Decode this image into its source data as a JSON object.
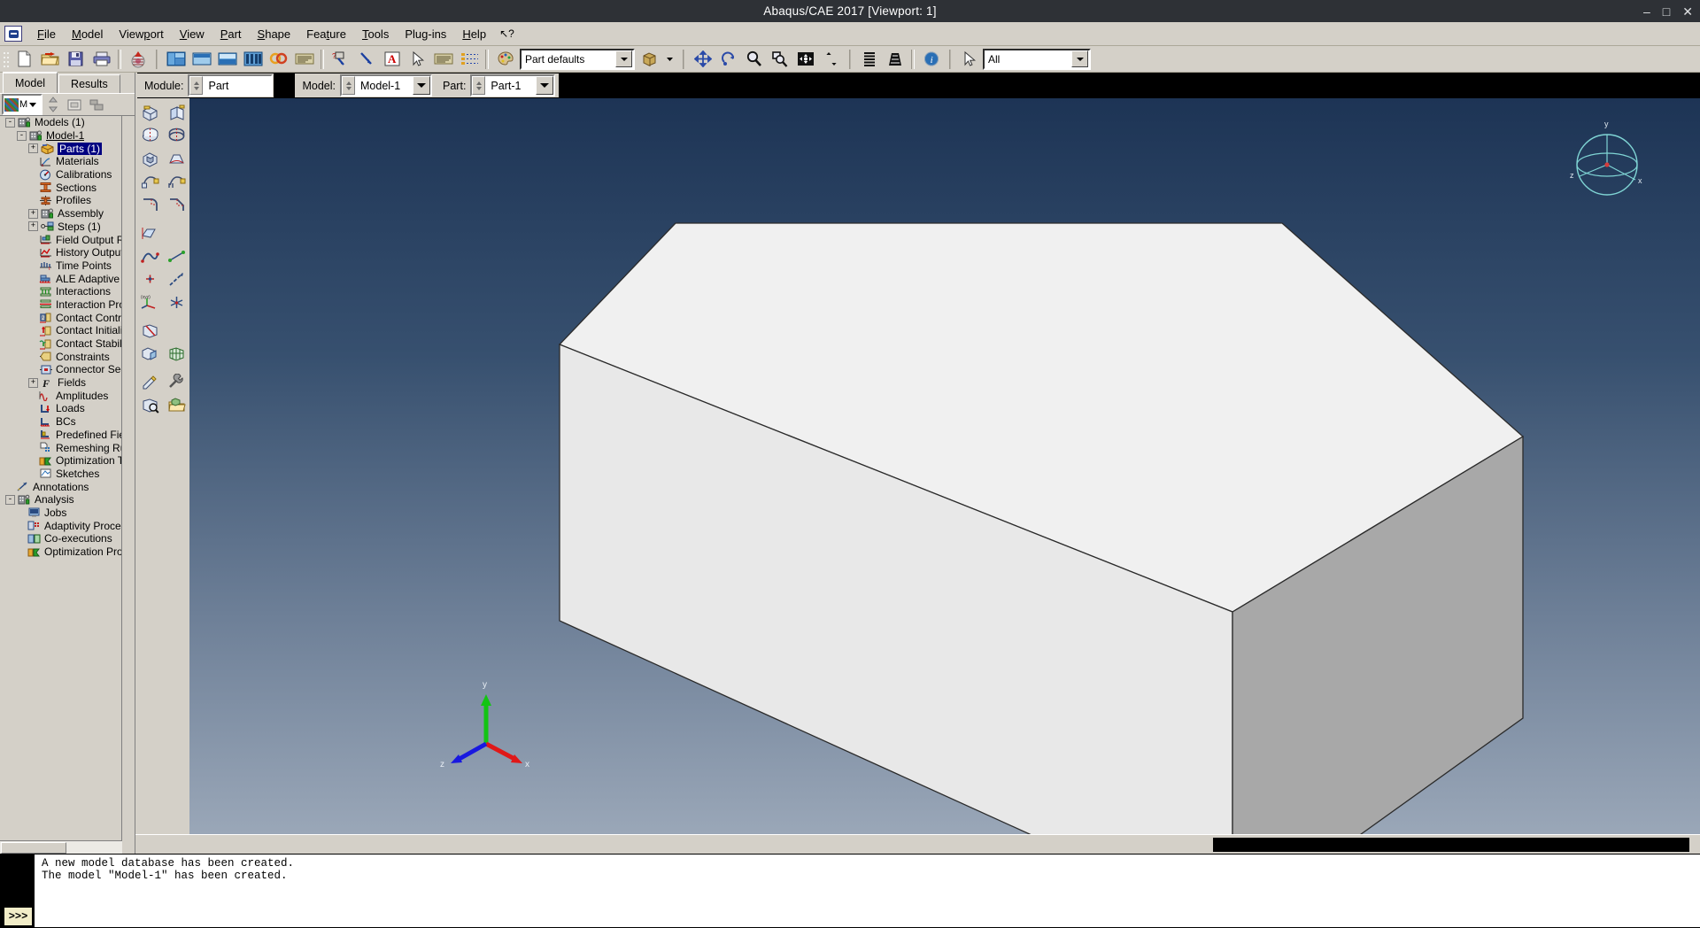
{
  "window": {
    "title": "Abaqus/CAE 2017 [Viewport: 1]",
    "minimize": "–",
    "maximize": "□",
    "close": "✕"
  },
  "menu": {
    "items": [
      {
        "label": "File",
        "accel_index": 0
      },
      {
        "label": "Model",
        "accel_index": 0
      },
      {
        "label": "Viewport",
        "accel_index": 4
      },
      {
        "label": "View",
        "accel_index": 0
      },
      {
        "label": "Part",
        "accel_index": 0
      },
      {
        "label": "Shape",
        "accel_index": 0
      },
      {
        "label": "Feature",
        "accel_index": 4
      },
      {
        "label": "Tools",
        "accel_index": 0
      },
      {
        "label": "Plug-ins",
        "accel_index": 4
      },
      {
        "label": "Help",
        "accel_index": 0
      }
    ],
    "help_arrow": "↖?"
  },
  "toolbar": {
    "file_group": [
      "new-model-database-icon",
      "open-database-icon",
      "save-database-icon",
      "print-icon"
    ],
    "abaqus_icon": "abaqus-home-icon",
    "viewport_group": [
      "create-viewport-icon",
      "tile-vertically-icon",
      "tile-horizontally-icon",
      "viewport-list-icon",
      "link-viewports-icon",
      "viewport-annotations-icon"
    ],
    "query_group": [
      "query-information-icon",
      "probe-values-icon",
      "annotation-text-icon",
      "selection-arrow-icon",
      "datum-icon",
      "display-group-icon"
    ],
    "render_combo_value": "Part defaults",
    "render_combo_placeholder": "Part defaults",
    "render_style_icon": "render-style-icon",
    "view_group": [
      "pan-icon",
      "rotate-icon",
      "magnify-icon",
      "box-zoom-icon",
      "auto-fit-icon",
      "cycle-views-icon"
    ],
    "perspective_group": [
      "perspective-icon",
      "no-perspective-icon"
    ],
    "info_icon": "viewport-info-icon",
    "select_arrow_icon": "select-entity-icon",
    "select_combo_value": "All",
    "select_combo_placeholder": "All"
  },
  "context": {
    "module_label": "Module:",
    "module_value": "Part",
    "model_label": "Model:",
    "model_value": "Model-1",
    "part_label": "Part:",
    "part_value": "Part-1"
  },
  "left_panel": {
    "tabs": [
      {
        "label": "Model",
        "active": true
      },
      {
        "label": "Results",
        "active": false
      }
    ],
    "tree_toolbar": {
      "model_selector_icon": "model-database-icon",
      "model_selector_value": "M",
      "switch_icon": "switch-context-icon",
      "container_icon": "container-icon",
      "filter_icon": "tree-filter-icon"
    },
    "tree": [
      {
        "depth": 0,
        "label": "Models (1)",
        "expander": "-",
        "icon": "models-icon",
        "selected": false,
        "underline": false
      },
      {
        "depth": 1,
        "label": "Model-1",
        "expander": "-",
        "icon": "model-icon",
        "selected": false,
        "underline": true
      },
      {
        "depth": 2,
        "label": "Parts (1)",
        "expander": "+",
        "icon": "parts-icon",
        "selected": true,
        "underline": false
      },
      {
        "depth": 2,
        "label": "Materials",
        "expander": "",
        "icon": "materials-icon",
        "selected": false,
        "underline": false
      },
      {
        "depth": 2,
        "label": "Calibrations",
        "expander": "",
        "icon": "calibrations-icon",
        "selected": false,
        "underline": false
      },
      {
        "depth": 2,
        "label": "Sections",
        "expander": "",
        "icon": "sections-icon",
        "selected": false,
        "underline": false
      },
      {
        "depth": 2,
        "label": "Profiles",
        "expander": "",
        "icon": "profiles-icon",
        "selected": false,
        "underline": false
      },
      {
        "depth": 2,
        "label": "Assembly",
        "expander": "+",
        "icon": "assembly-icon",
        "selected": false,
        "underline": false
      },
      {
        "depth": 2,
        "label": "Steps (1)",
        "expander": "+",
        "icon": "steps-icon",
        "selected": false,
        "underline": false
      },
      {
        "depth": 2,
        "label": "Field Output Requests",
        "expander": "",
        "icon": "field-output-icon",
        "selected": false,
        "underline": false
      },
      {
        "depth": 2,
        "label": "History Output Requests",
        "expander": "",
        "icon": "history-output-icon",
        "selected": false,
        "underline": false
      },
      {
        "depth": 2,
        "label": "Time Points",
        "expander": "",
        "icon": "time-points-icon",
        "selected": false,
        "underline": false
      },
      {
        "depth": 2,
        "label": "ALE Adaptive Mesh Constraints",
        "expander": "",
        "icon": "ale-adaptive-icon",
        "selected": false,
        "underline": false
      },
      {
        "depth": 2,
        "label": "Interactions",
        "expander": "",
        "icon": "interactions-icon",
        "selected": false,
        "underline": false
      },
      {
        "depth": 2,
        "label": "Interaction Properties",
        "expander": "",
        "icon": "interaction-properties-icon",
        "selected": false,
        "underline": false
      },
      {
        "depth": 2,
        "label": "Contact Controls",
        "expander": "",
        "icon": "contact-controls-icon",
        "selected": false,
        "underline": false
      },
      {
        "depth": 2,
        "label": "Contact Initializations",
        "expander": "",
        "icon": "contact-initializations-icon",
        "selected": false,
        "underline": false
      },
      {
        "depth": 2,
        "label": "Contact Stabilizations",
        "expander": "",
        "icon": "contact-stabilizations-icon",
        "selected": false,
        "underline": false
      },
      {
        "depth": 2,
        "label": "Constraints",
        "expander": "",
        "icon": "constraints-icon",
        "selected": false,
        "underline": false
      },
      {
        "depth": 2,
        "label": "Connector Sections",
        "expander": "",
        "icon": "connector-sections-icon",
        "selected": false,
        "underline": false
      },
      {
        "depth": 2,
        "label": "Fields",
        "expander": "+",
        "icon": "fields-icon",
        "selected": false,
        "underline": false
      },
      {
        "depth": 2,
        "label": "Amplitudes",
        "expander": "",
        "icon": "amplitudes-icon",
        "selected": false,
        "underline": false
      },
      {
        "depth": 2,
        "label": "Loads",
        "expander": "",
        "icon": "loads-icon",
        "selected": false,
        "underline": false
      },
      {
        "depth": 2,
        "label": "BCs",
        "expander": "",
        "icon": "bcs-icon",
        "selected": false,
        "underline": false
      },
      {
        "depth": 2,
        "label": "Predefined Fields",
        "expander": "",
        "icon": "predefined-fields-icon",
        "selected": false,
        "underline": false
      },
      {
        "depth": 2,
        "label": "Remeshing Rules",
        "expander": "",
        "icon": "remeshing-rules-icon",
        "selected": false,
        "underline": false
      },
      {
        "depth": 2,
        "label": "Optimization Tasks",
        "expander": "",
        "icon": "optimization-tasks-icon",
        "selected": false,
        "underline": false
      },
      {
        "depth": 2,
        "label": "Sketches",
        "expander": "",
        "icon": "sketches-icon",
        "selected": false,
        "underline": false
      },
      {
        "depth": 0,
        "label": "Annotations",
        "expander": "",
        "icon": "annotations-icon",
        "selected": false,
        "underline": false
      },
      {
        "depth": 0,
        "label": "Analysis",
        "expander": "-",
        "icon": "analysis-icon",
        "selected": false,
        "underline": false
      },
      {
        "depth": 1,
        "label": "Jobs",
        "expander": "",
        "icon": "jobs-icon",
        "selected": false,
        "underline": false
      },
      {
        "depth": 1,
        "label": "Adaptivity Processes",
        "expander": "",
        "icon": "adaptivity-icon",
        "selected": false,
        "underline": false
      },
      {
        "depth": 1,
        "label": "Co-executions",
        "expander": "",
        "icon": "coexecutions-icon",
        "selected": false,
        "underline": false
      },
      {
        "depth": 1,
        "label": "Optimization Processes",
        "expander": "",
        "icon": "optimization-processes-icon",
        "selected": false,
        "underline": false
      }
    ]
  },
  "module_toolbox": {
    "rows": [
      [
        "create-solid-extrude-icon",
        "create-shell-extrude-icon"
      ],
      [
        "create-solid-revolve-icon",
        "create-shell-revolve-icon"
      ],
      [
        "create-cut-extrude-icon",
        "create-blend-icon"
      ],
      [
        "create-solid-sweep-icon",
        "create-shell-sweep-icon"
      ],
      [
        "create-round-fillet-icon",
        "create-chamfer-icon"
      ],
      [
        "create-shell-planar-icon",
        ""
      ],
      [
        "create-wire-icon",
        "create-wire-point-icon"
      ],
      [
        "create-point-icon",
        "create-datum-axis-icon"
      ],
      [
        "create-datum-csys-icon",
        "create-datum-plane-icon"
      ],
      [
        "partition-face-icon",
        ""
      ],
      [
        "merge-cut-icon",
        "create-mesh-part-icon"
      ],
      [
        "edit-feature-icon",
        "repair-tools-icon"
      ],
      [
        "query-part-icon",
        "part-manager-icon"
      ]
    ]
  },
  "viewport": {
    "name": "Viewport: 1",
    "corner_triad": {
      "x_label": "x",
      "y_label": "y",
      "z_label": "z"
    },
    "origin_triad": {
      "x_label": "x",
      "y_label": "y",
      "z_label": "z"
    },
    "geometry": "rectangular-box-part",
    "background_top": "#1d3455",
    "background_bottom": "#9aa7b8",
    "face_top_color": "#efefef",
    "face_front_color": "#e4e4e4",
    "face_side_color": "#a9a9a9"
  },
  "message_area": {
    "prompt_symbol": ">>>",
    "lines": [
      "A new model database has been created.",
      "The model \"Model-1\" has been created."
    ],
    "text": "A new model database has been created.\nThe model \"Model-1\" has been created."
  }
}
